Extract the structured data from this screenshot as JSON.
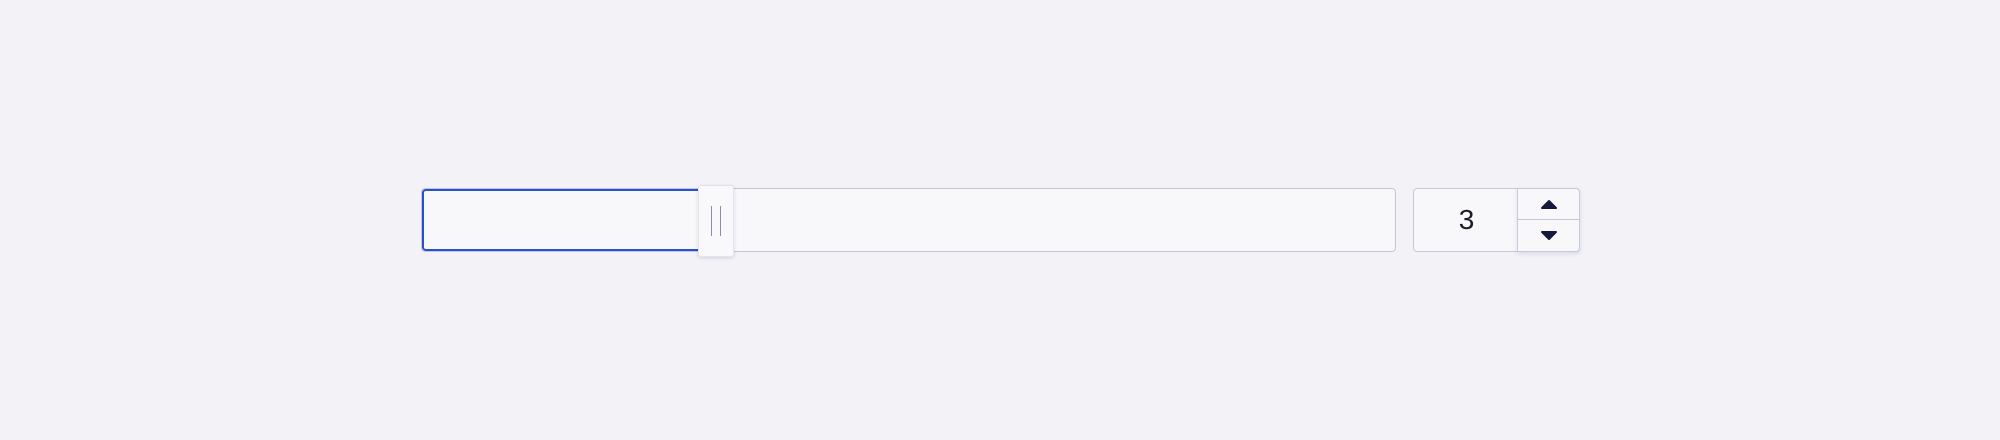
{
  "slider": {
    "min": 0,
    "max": 36,
    "value": 3,
    "fill_fraction": 0.285
  },
  "stepper": {
    "value": "3",
    "up_icon": "caret-up-icon",
    "down_icon": "caret-down-icon"
  },
  "colors": {
    "background": "#f2f2f7",
    "accent": "#2a4fd3",
    "border": "#c3c6d6",
    "text": "#1a1c2b"
  }
}
